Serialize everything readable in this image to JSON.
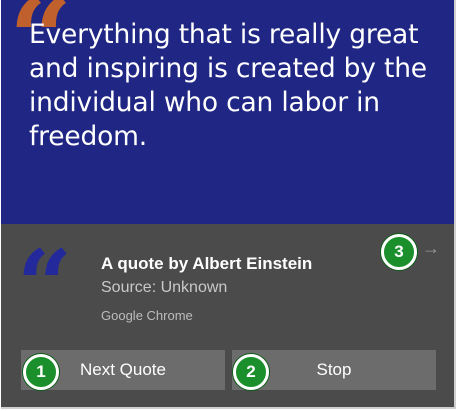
{
  "notification": {
    "hero_text": "Everything that is really great and inspiring is created by the individual who can labor in freedom.",
    "hero_quote_mark": "“",
    "quote_mark": "“",
    "title": "A quote by Albert Einstein",
    "source": "Source: Unknown",
    "app_name": "Google Chrome",
    "dismiss_glyph": "→"
  },
  "buttons": {
    "next_label": "Next Quote",
    "stop_label": "Stop"
  },
  "callouts": [
    "1",
    "2",
    "3"
  ],
  "colors": {
    "hero_background": "#1f2683",
    "panel_background": "#4b4b4b",
    "button_background": "#6c6c6c",
    "hero_quote_mark": "#c0602d",
    "panel_quote_mark": "#23289a",
    "callout_badge": "#1a8f2c"
  },
  "icons": {
    "hero_quote": "quote-mark-icon",
    "panel_quote": "quote-mark-icon",
    "dismiss": "arrow-right-icon"
  }
}
